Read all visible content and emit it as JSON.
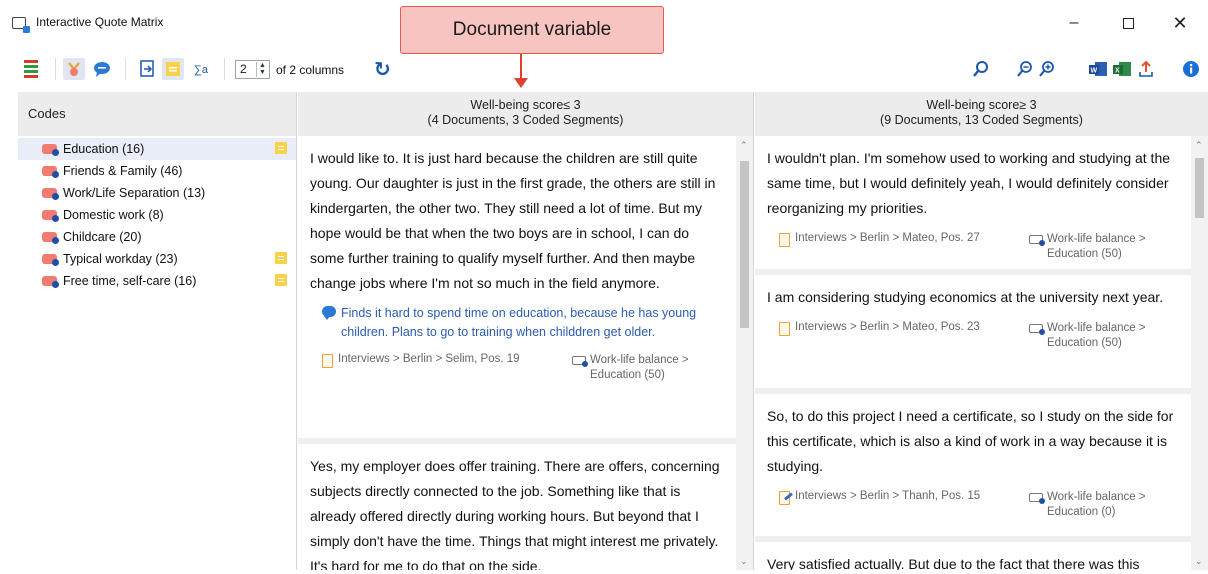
{
  "window": {
    "title": "Interactive Quote Matrix"
  },
  "callout": {
    "label": "Document variable"
  },
  "toolbar": {
    "columns_value": "2",
    "columns_suffix": "of 2 columns"
  },
  "codes": {
    "header": "Codes",
    "items": [
      {
        "label": "Education (16)",
        "memo": true,
        "selected": true
      },
      {
        "label": "Friends & Family (46)",
        "memo": false
      },
      {
        "label": "Work/Life Separation (13)",
        "memo": false
      },
      {
        "label": "Domestic work (8)",
        "memo": false
      },
      {
        "label": "Childcare (20)",
        "memo": false
      },
      {
        "label": "Typical workday (23)",
        "memo": true
      },
      {
        "label": "Free time, self-care (16)",
        "memo": true
      }
    ]
  },
  "columns": [
    {
      "header_line1": "Well-being score≤ 3",
      "header_line2": "(4 Documents, 3 Coded Segments)",
      "cards": [
        {
          "text": "I would like to. It is just hard because the children are still quite young. Our daughter is just in the first grade, the others are still in kindergarten, the other two. They still need a lot of time. But my hope would be that when the two boys are in school, I can do some further training to qualify myself further. And then maybe change jobs where I'm not so much in the field anymore.",
          "memo": "Finds it hard to spend time on education, because he has young children. Plans to go to training when childdren get older.",
          "source": "Interviews > Berlin > Selim, Pos. 19",
          "code_line1": "Work-life balance >",
          "code_line2": "Education (50)"
        },
        {
          "text": "Yes, my employer does offer training. There are offers, concerning subjects directly connected to the job. Something like that is already offered directly during working hours. But beyond that I simply don't have the time. Things that might interest me privately. It's hard for me to do that on the side."
        }
      ]
    },
    {
      "header_line1": "Well-being score≥ 3",
      "header_line2": "(9 Documents, 13 Coded Segments)",
      "cards": [
        {
          "text": "I wouldn't plan. I'm somehow used to working and studying at the same time, but I would definitely yeah, I would definitely consider reorganizing my priorities.",
          "source": "Interviews > Berlin > Mateo, Pos. 27",
          "code_line1": "Work-life balance >",
          "code_line2": "Education (50)"
        },
        {
          "text": "I am considering studying economics at the university next year.",
          "source": "Interviews > Berlin > Mateo, Pos. 23",
          "code_line1": "Work-life balance >",
          "code_line2": "Education (50)"
        },
        {
          "text": "So, to do this project I need a certificate, so I study on the side for this certificate, which is also a kind of work in a way because it is studying.",
          "source": "Interviews > Berlin > Thanh, Pos. 15",
          "code_line1": "Work-life balance >",
          "code_line2": "Education (0)"
        },
        {
          "text": "Very satisfied actually. But due to the fact that there was this"
        }
      ]
    }
  ],
  "colors": {
    "accent": "#1a58b0",
    "callout_fill": "#f7c4c1",
    "callout_border": "#e05a4d",
    "code_color": "#f07b6e",
    "memo_yellow": "#f9d24a"
  }
}
